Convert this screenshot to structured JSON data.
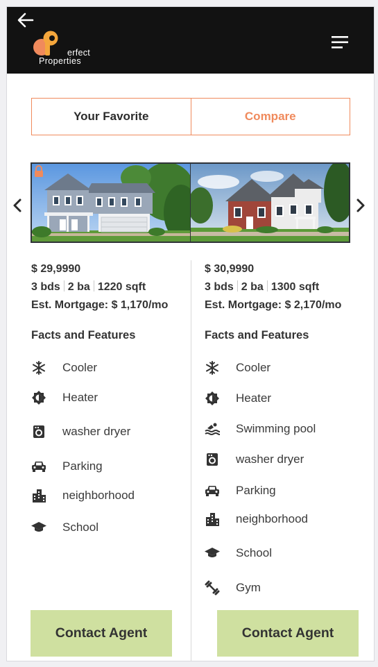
{
  "header": {
    "back_icon": "arrow-left-icon",
    "menu_icon": "hamburger-menu-icon",
    "logo": {
      "word": "erfect",
      "sub": "Properties",
      "colors": {
        "a": "#f08a5c",
        "p": "#f4a63c"
      }
    }
  },
  "tabs": [
    {
      "label": "Your Favorite",
      "active": false
    },
    {
      "label": "Compare",
      "active": true
    }
  ],
  "carousel": {
    "prev_icon": "chevron-left-icon",
    "next_icon": "chevron-right-icon",
    "lock_icon": "lock-icon"
  },
  "colors": {
    "accent": "#f08a5c",
    "header_bg": "#121212",
    "cta_bg": "#cfe0a0"
  },
  "listings": [
    {
      "price": "$ 29,9990",
      "beds": "3 bds",
      "baths": "2 ba",
      "sqft": "1220 sqft",
      "mortgage": "Est. Mortgage: $ 1,170/mo",
      "facts_title": "Facts and Features",
      "features": [
        {
          "icon": "snowflake-icon",
          "label": "Cooler"
        },
        {
          "icon": "brightness-icon",
          "label": "Heater"
        },
        {
          "icon": "washer-icon",
          "label": "washer dryer"
        },
        {
          "icon": "car-icon",
          "label": "Parking"
        },
        {
          "icon": "city-icon",
          "label": "neighborhood"
        },
        {
          "icon": "school-icon",
          "label": "School"
        }
      ],
      "cta": "Contact Agent"
    },
    {
      "price": "$ 30,9990",
      "beds": "3 bds",
      "baths": "2 ba",
      "sqft": "1300 sqft",
      "mortgage": "Est. Mortgage: $ 2,170/mo",
      "facts_title": "Facts and Features",
      "features": [
        {
          "icon": "snowflake-icon",
          "label": "Cooler"
        },
        {
          "icon": "brightness-icon",
          "label": "Heater"
        },
        {
          "icon": "pool-icon",
          "label": "Swimming pool"
        },
        {
          "icon": "washer-icon",
          "label": "washer dryer"
        },
        {
          "icon": "car-icon",
          "label": "Parking"
        },
        {
          "icon": "city-icon",
          "label": "neighborhood"
        },
        {
          "icon": "school-icon",
          "label": "School"
        },
        {
          "icon": "gym-icon",
          "label": "Gym"
        }
      ],
      "cta": "Contact Agent"
    }
  ]
}
